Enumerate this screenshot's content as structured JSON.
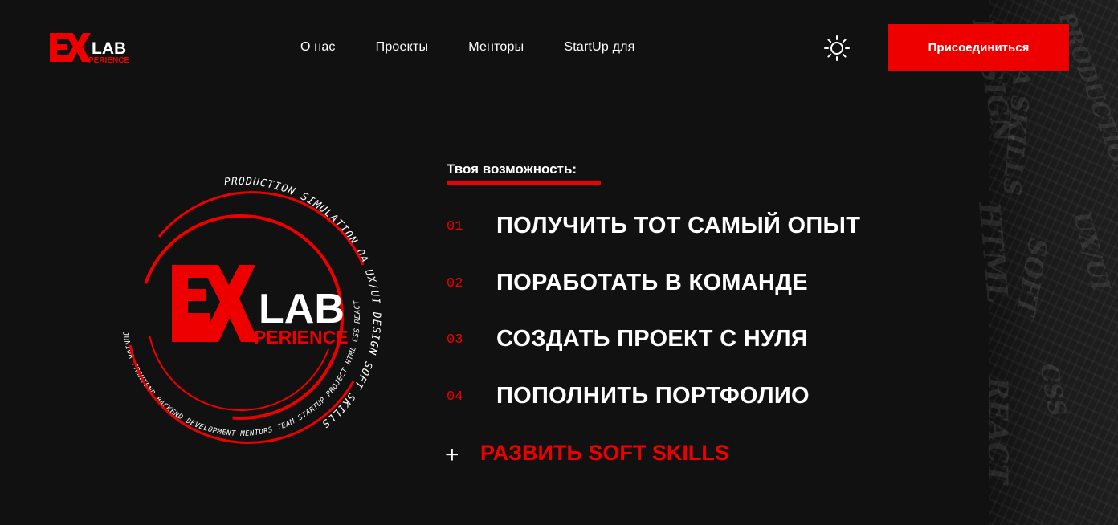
{
  "brand": {
    "logo_ex": "EX",
    "logo_lab": "LAB",
    "logo_sub": "PERIENCE"
  },
  "nav": {
    "items": [
      {
        "label": "О нас"
      },
      {
        "label": "Проекты"
      },
      {
        "label": "Менторы"
      },
      {
        "label": "StartUp для"
      }
    ]
  },
  "header": {
    "theme_icon": "sun-icon",
    "join_label": "Присоединиться"
  },
  "hero": {
    "ring_text_outer": "PRODUCTION SIMULATION QA UX/UI DESIGN SOFT SKILLS",
    "ring_text_inner": "JUNIOR FRONTEND BACKEND DEVELOPMENT MENTORS TEAM STARTUP PROJECT HTML CSS REACT",
    "emblem_ex": "EX",
    "emblem_lab": "LAB",
    "emblem_sub": "PERIENCE"
  },
  "opportunities": {
    "kicker": "Твоя возможность:",
    "items": [
      {
        "num": "01",
        "text": "ПОЛУЧИТЬ ТОТ САМЫЙ ОПЫТ"
      },
      {
        "num": "02",
        "text": "ПОРАБОТАТЬ В КОМАНДЕ"
      },
      {
        "num": "03",
        "text": "СОЗДАТЬ ПРОЕКТ С НУЛЯ"
      },
      {
        "num": "04",
        "text": "ПОПОЛНИТЬ ПОРТФОЛИО"
      }
    ],
    "plus_symbol": "+",
    "extra": "РАЗВИТЬ SOFT SKILLS"
  },
  "colors": {
    "accent": "#ee0000",
    "background": "#111111",
    "text": "#ffffff"
  }
}
